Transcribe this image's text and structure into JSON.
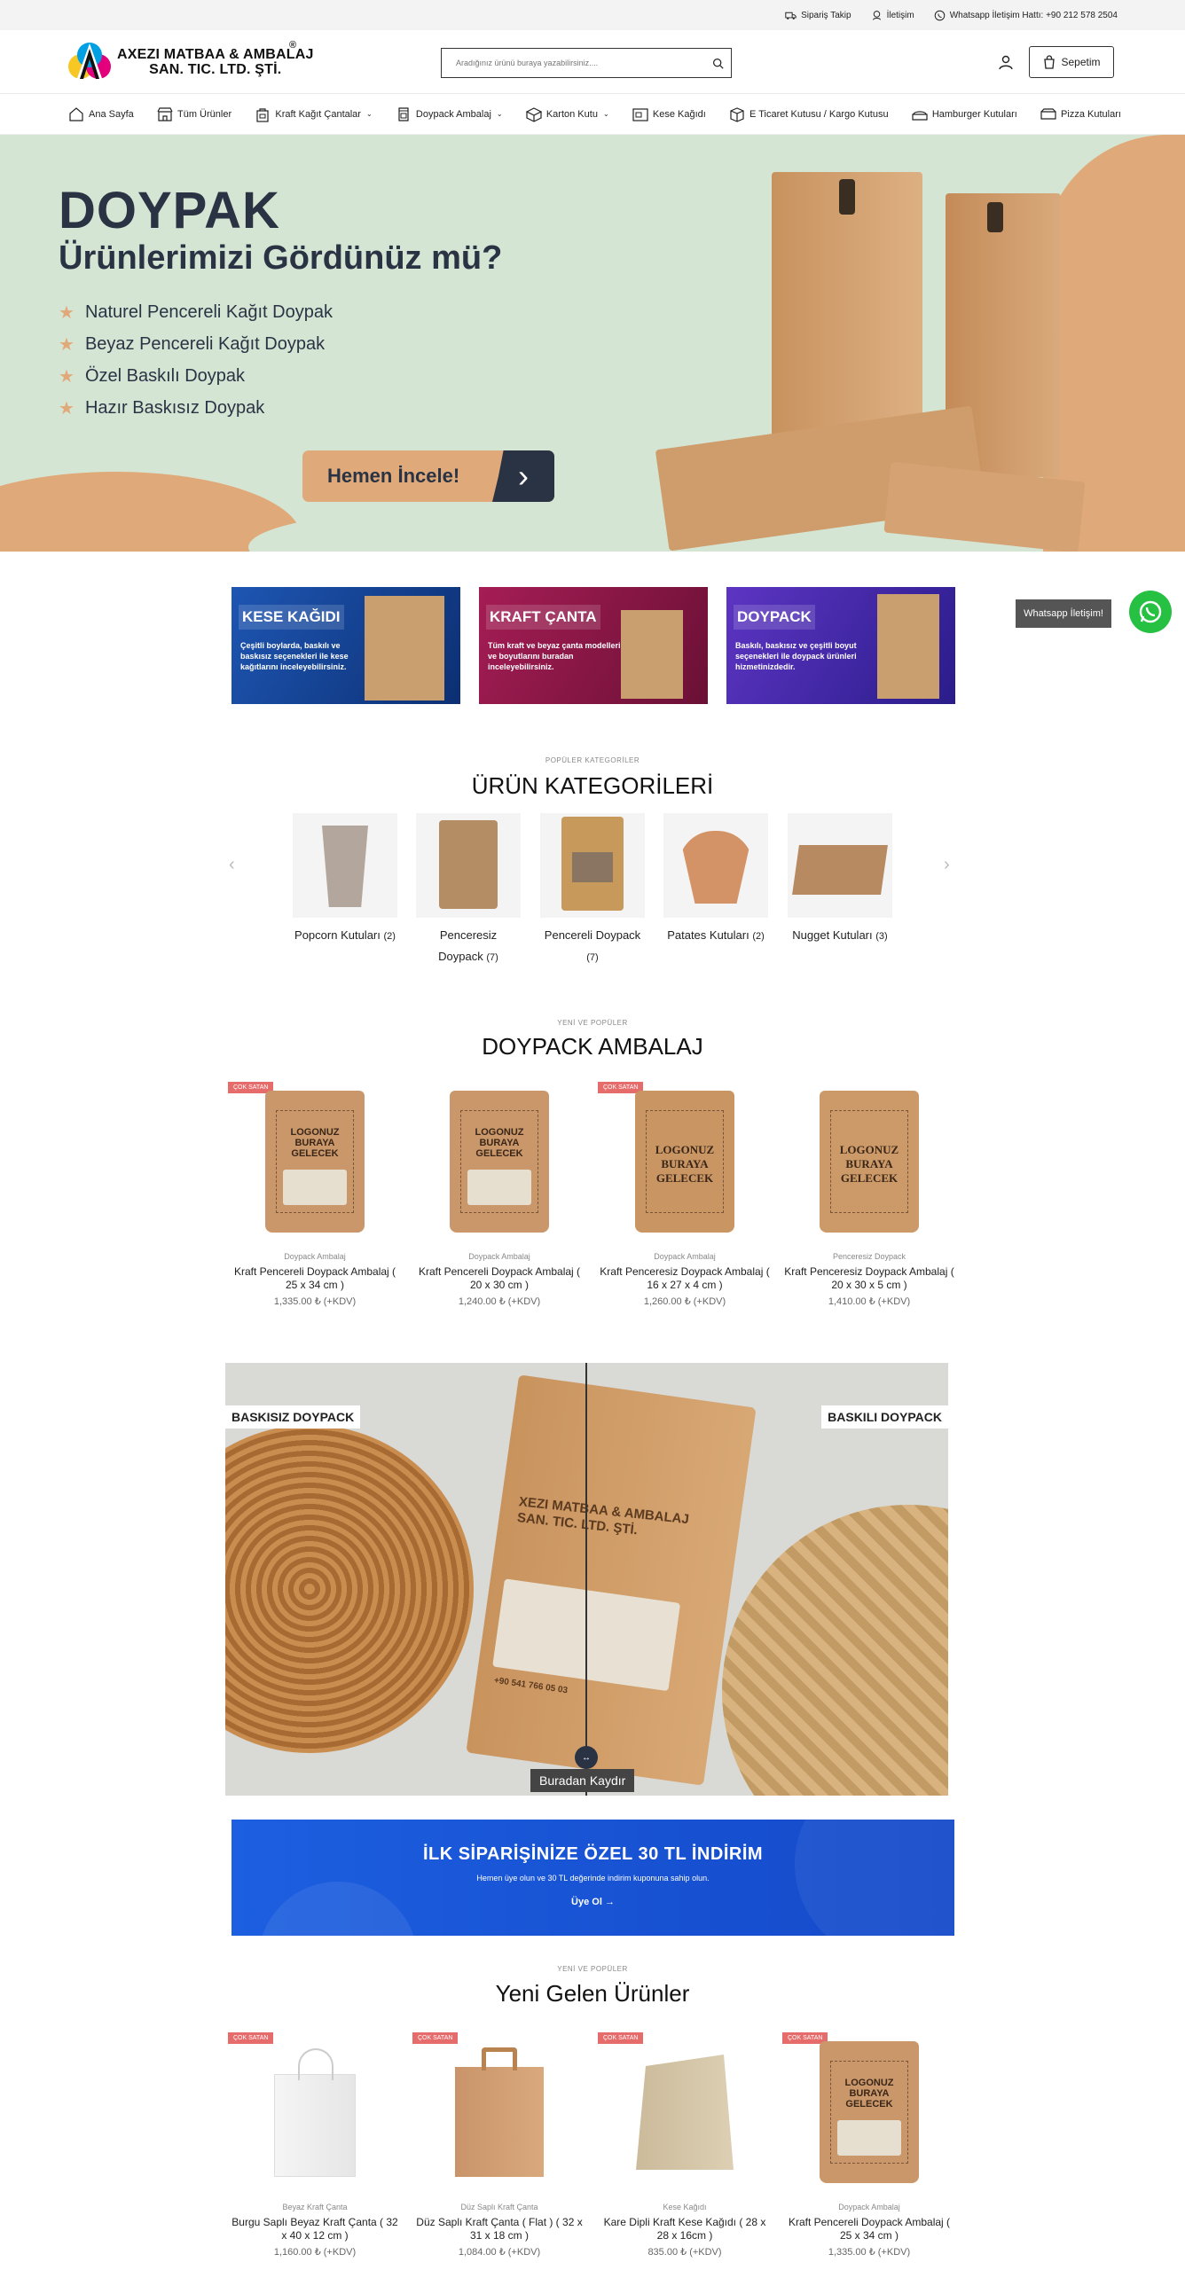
{
  "topbar": {
    "order_track": "Sipariş Takip",
    "contact": "İletişim",
    "whatsapp": "Whatsapp İletişim Hattı: +90 212 578 2504"
  },
  "header": {
    "logo_line1": "AXEZI MATBAA & AMBALAJ",
    "logo_line2": "SAN. TIC. LTD. ŞTİ.",
    "logo_reg": "®",
    "search_placeholder": "Aradığınız ürünü buraya yazabilirsiniz....",
    "cart_label": "Sepetim"
  },
  "nav": [
    {
      "label": "Ana Sayfa",
      "icon": "home-icon",
      "chev": false
    },
    {
      "label": "Tüm Ürünler",
      "icon": "store-icon",
      "chev": false
    },
    {
      "label": "Kraft Kağıt Çantalar",
      "icon": "bag-icon",
      "chev": true
    },
    {
      "label": "Doypack Ambalaj",
      "icon": "pouch-icon",
      "chev": true
    },
    {
      "label": "Karton Kutu",
      "icon": "box-icon",
      "chev": true
    },
    {
      "label": "Kese Kağıdı",
      "icon": "paper-bag-icon",
      "chev": false
    },
    {
      "label": "E Ticaret Kutusu / Kargo Kutusu",
      "icon": "shipping-box-icon",
      "chev": false
    },
    {
      "label": "Hamburger Kutuları",
      "icon": "burger-box-icon",
      "chev": false
    },
    {
      "label": "Pizza Kutuları",
      "icon": "pizza-box-icon",
      "chev": false
    }
  ],
  "hero": {
    "title": "DOYPAK",
    "subtitle": "Ürünlerimizi Gördünüz mü?",
    "items": [
      "Naturel Pencereli Kağıt Doypak",
      "Beyaz Pencereli Kağıt Doypak",
      "Özel Baskılı Doypak",
      "Hazır Baskısız Doypak"
    ],
    "cta": "Hemen İncele!"
  },
  "whatsapp_tip": "Whatsapp İletişim!",
  "banners": [
    {
      "title": "KESE KAĞIDI",
      "desc": "Çeşitli boylarda, baskılı ve baskısız seçenekleri ile kese kağıtlarını inceleyebilirsiniz.",
      "color": "#1d4fa8"
    },
    {
      "title": "KRAFT ÇANTA",
      "desc": "Tüm kraft ve beyaz çanta modelleri ve boyutlarını buradan inceleyebilirsiniz.",
      "color": "#9c1d4c"
    },
    {
      "title": "DOYPACK",
      "desc": "Baskılı, baskısız ve çeşitli boyut seçenekleri ile doypack ürünleri hizmetinizdedir.",
      "color": "#5330b8"
    }
  ],
  "categories": {
    "sub": "POPÜLER KATEGORİLER",
    "title": "ÜRÜN KATEGORİLERİ",
    "items": [
      {
        "name": "Popcorn Kutuları",
        "count": "(2)"
      },
      {
        "name": "Penceresiz Doypack",
        "count": "(7)"
      },
      {
        "name": "Pencereli Doypack",
        "count": "(7)"
      },
      {
        "name": "Patates Kutuları",
        "count": "(2)"
      },
      {
        "name": "Nugget Kutuları",
        "count": "(3)"
      }
    ]
  },
  "doypack": {
    "sub": "YENİ VE POPÜLER",
    "title": "DOYPACK AMBALAJ",
    "products": [
      {
        "badge": "ÇOK SATAN",
        "cat": "Doypack Ambalaj",
        "name": "Kraft Pencereli Doypack Ambalaj ( 25 x 34 cm )",
        "price": "1,335.00 ₺ (+KDV)",
        "label": "LOGONUZ BURAYA GELECEK"
      },
      {
        "badge": "",
        "cat": "Doypack Ambalaj",
        "name": "Kraft Pencereli Doypack Ambalaj ( 20 x 30 cm )",
        "price": "1,240.00 ₺ (+KDV)",
        "label": "LOGONUZ BURAYA GELECEK"
      },
      {
        "badge": "ÇOK SATAN",
        "cat": "Doypack Ambalaj",
        "name": "Kraft Penceresiz Doypack Ambalaj ( 16 x 27 x 4 cm )",
        "price": "1,260.00 ₺ (+KDV)",
        "label": "LOGONUZ BURAYA GELECEK"
      },
      {
        "badge": "",
        "cat": "Penceresiz Doypack",
        "name": "Kraft Penceresiz Doypack Ambalaj ( 20 x 30 x 5 cm )",
        "price": "1,410.00 ₺ (+KDV)",
        "label": "LOGONUZ BURAYA GELECEK"
      }
    ]
  },
  "compare": {
    "left_label": "BASKISIZ DOYPACK",
    "right_label": "BASKILI DOYPACK",
    "scroll_hint": "Buradan Kaydır",
    "bag_text": "XEZI MATBAA & AMBALAJ SAN. TIC. LTD. ŞTİ.",
    "bag_phone": "+90 541 766 05 03"
  },
  "promo": {
    "title": "İLK SİPARİŞİNİZE ÖZEL 30 TL İNDİRİM",
    "subtitle": "Hemen üye olun ve 30 TL değerinde indirim kuponuna sahip olun.",
    "link": "Üye Ol →"
  },
  "new_products": {
    "sub": "YENİ VE POPÜLER",
    "title": "Yeni Gelen Ürünler",
    "products": [
      {
        "badge": "ÇOK SATAN",
        "cat": "Beyaz Kraft Çanta",
        "name": "Burgu Saplı Beyaz Kraft Çanta ( 32 x 40 x 12 cm )",
        "price": "1,160.00 ₺ (+KDV)"
      },
      {
        "badge": "ÇOK SATAN",
        "cat": "Düz Saplı Kraft Çanta",
        "name": "Düz Saplı Kraft Çanta ( Flat ) ( 32 x 31 x 18 cm )",
        "price": "1,084.00 ₺ (+KDV)"
      },
      {
        "badge": "ÇOK SATAN",
        "cat": "Kese Kağıdı",
        "name": "Kare Dipli Kraft Kese Kağıdı ( 28 x 28 x 16cm )",
        "price": "835.00 ₺ (+KDV)"
      },
      {
        "badge": "ÇOK SATAN",
        "cat": "Doypack Ambalaj",
        "name": "Kraft Pencereli Doypack Ambalaj ( 25 x 34 cm )",
        "price": "1,335.00 ₺ (+KDV)",
        "label": "LOGONUZ BURAYA GELECEK"
      }
    ]
  }
}
